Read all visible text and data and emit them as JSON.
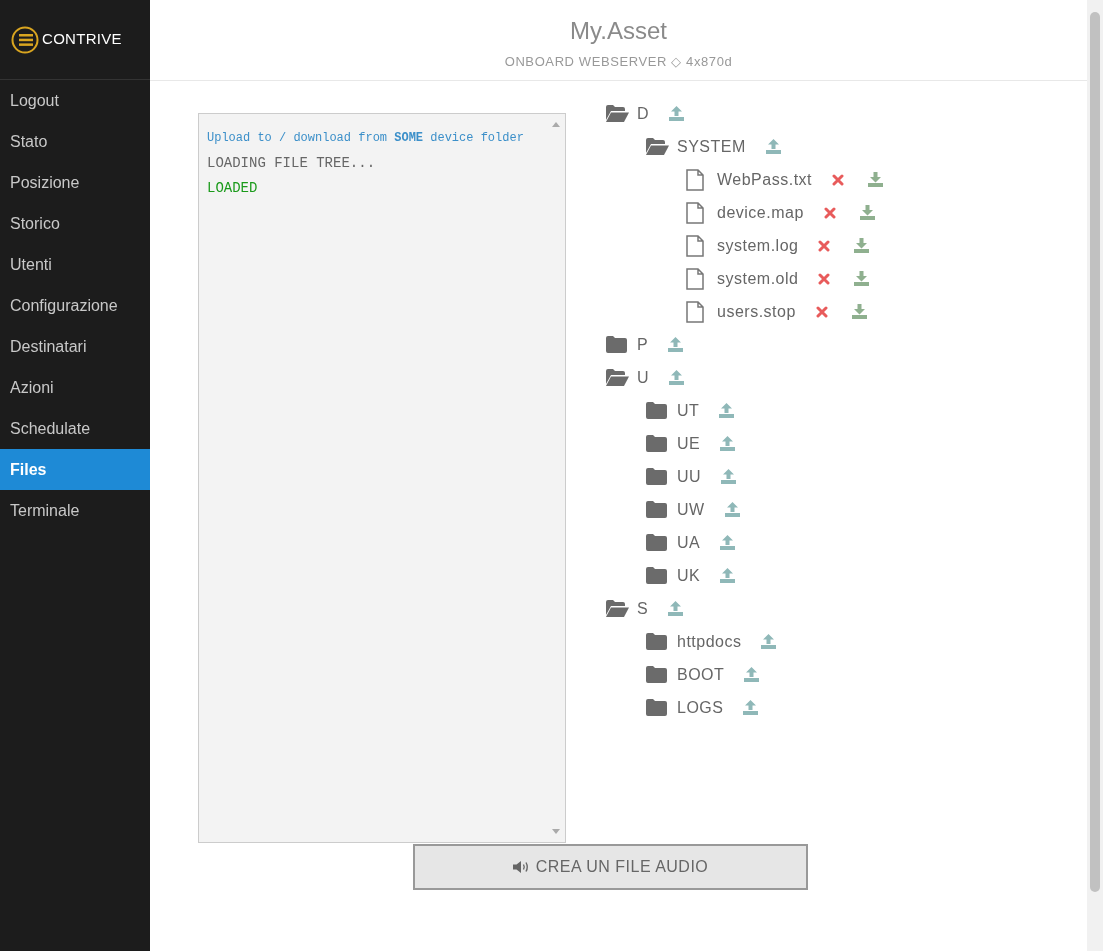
{
  "logo": {
    "text": "CONTRIVE"
  },
  "sidebar": {
    "items": [
      {
        "label": "Logout",
        "selected": false
      },
      {
        "label": "Stato",
        "selected": false
      },
      {
        "label": "Posizione",
        "selected": false
      },
      {
        "label": "Storico",
        "selected": false
      },
      {
        "label": "Utenti",
        "selected": false
      },
      {
        "label": "Configurazione",
        "selected": false
      },
      {
        "label": "Destinatari",
        "selected": false
      },
      {
        "label": "Azioni",
        "selected": false
      },
      {
        "label": "Schedulate",
        "selected": false
      },
      {
        "label": "Files",
        "selected": true
      },
      {
        "label": "Terminale",
        "selected": false
      }
    ]
  },
  "header": {
    "title": "My.Asset",
    "subtitle": "ONBOARD WEBSERVER ◇ 4x870d"
  },
  "console": {
    "lines": [
      {
        "kind": "hint",
        "text": "Upload to / download from **SOME** device folder"
      },
      {
        "kind": "plain",
        "text": "LOADING FILE TREE..."
      },
      {
        "kind": "success",
        "text": "LOADED"
      }
    ]
  },
  "tree": [
    {
      "kind": "folder",
      "name": "D",
      "expanded": true,
      "children": [
        {
          "kind": "folder",
          "name": "SYSTEM",
          "expanded": true,
          "children": [
            {
              "kind": "file",
              "name": "WebPass.txt"
            },
            {
              "kind": "file",
              "name": "device.map"
            },
            {
              "kind": "file",
              "name": "system.log"
            },
            {
              "kind": "file",
              "name": "system.old"
            },
            {
              "kind": "file",
              "name": "users.stop"
            }
          ]
        }
      ]
    },
    {
      "kind": "folder",
      "name": "P",
      "expanded": false
    },
    {
      "kind": "folder",
      "name": "U",
      "expanded": true,
      "children": [
        {
          "kind": "folder",
          "name": "UT",
          "expanded": false
        },
        {
          "kind": "folder",
          "name": "UE",
          "expanded": false
        },
        {
          "kind": "folder",
          "name": "UU",
          "expanded": false
        },
        {
          "kind": "folder",
          "name": "UW",
          "expanded": false
        },
        {
          "kind": "folder",
          "name": "UA",
          "expanded": false
        },
        {
          "kind": "folder",
          "name": "UK",
          "expanded": false
        }
      ]
    },
    {
      "kind": "folder",
      "name": "S",
      "expanded": true,
      "children": [
        {
          "kind": "folder",
          "name": "httpdocs",
          "expanded": false
        },
        {
          "kind": "folder",
          "name": "BOOT",
          "expanded": false
        },
        {
          "kind": "folder",
          "name": "LOGS",
          "expanded": false
        }
      ]
    }
  ],
  "audio_button": {
    "label": "CREA UN FILE AUDIO"
  }
}
